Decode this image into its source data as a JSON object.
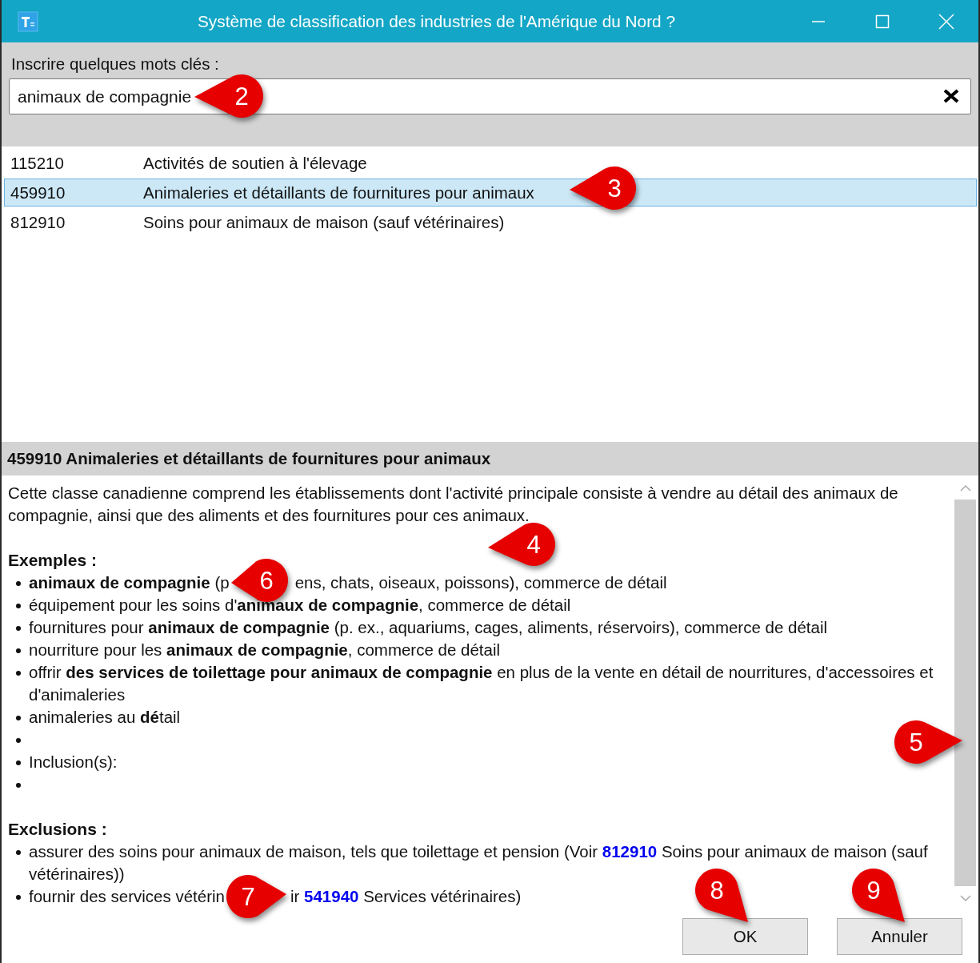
{
  "window": {
    "title": "Système de classification des industries de l'Amérique du Nord ?"
  },
  "search": {
    "label": "Inscrire quelques mots clés :",
    "value": "animaux de compagnie"
  },
  "results": [
    {
      "code": "115210",
      "title": "Activités de soutien à l'élevage",
      "selected": false
    },
    {
      "code": "459910",
      "title": "Animaleries et détaillants de fournitures pour animaux",
      "selected": true
    },
    {
      "code": "812910",
      "title": "Soins pour animaux de maison (sauf vétérinaires)",
      "selected": false
    }
  ],
  "detail": {
    "heading": "459910 Animaleries et détaillants de fournitures pour animaux",
    "description": "Cette classe canadienne comprend les établissements dont l'activité principale consiste à vendre au détail des animaux de compagnie, ainsi que des aliments et des fournitures pour ces animaux.",
    "examples_heading": "Exemples :",
    "examples": [
      {
        "kind": "split",
        "segments": [
          "**animaux de compagnie** (p",
          "ens, chats, oiseaux, poissons), commerce de détail"
        ]
      },
      {
        "kind": "text",
        "text": "équipement pour les soins d'**animaux de compagnie**, commerce de détail"
      },
      {
        "kind": "text",
        "text": "fournitures pour **animaux de compagnie** (p. ex., aquariums, cages, aliments, réservoirs), commerce de détail"
      },
      {
        "kind": "text",
        "text": "nourriture pour les **animaux de compagnie**, commerce de détail"
      },
      {
        "kind": "text",
        "text": "offrir **des services de toilettage pour animaux de compagnie** en plus de la vente en détail de nourritures, d'accessoires et d'animaleries"
      },
      {
        "kind": "text",
        "text": "animaleries au **dé**tail"
      },
      {
        "kind": "blank"
      },
      {
        "kind": "text",
        "text": "Inclusion(s):"
      },
      {
        "kind": "blank"
      }
    ],
    "exclusions_heading": "Exclusions :",
    "exclusions": [
      {
        "parts": [
          {
            "before": "assurer des soins pour animaux de maison, tels que toilettage et pension (Voir ",
            "link": "812910",
            "after": " Soins pour animaux de maison (sauf vétérinaires))"
          }
        ]
      },
      {
        "parts": [
          {
            "before": "fournir des services vétérin"
          },
          {
            "before": "ir ",
            "link": "541940",
            "after": " Services vétérinaires)"
          }
        ]
      }
    ]
  },
  "buttons": [
    {
      "label": "OK"
    },
    {
      "label": "Annuler"
    }
  ],
  "callouts": [
    {
      "label": "2"
    },
    {
      "label": "3"
    },
    {
      "label": "4"
    },
    {
      "label": "5"
    },
    {
      "label": "6"
    },
    {
      "label": "7"
    },
    {
      "label": "8"
    },
    {
      "label": "9"
    }
  ]
}
